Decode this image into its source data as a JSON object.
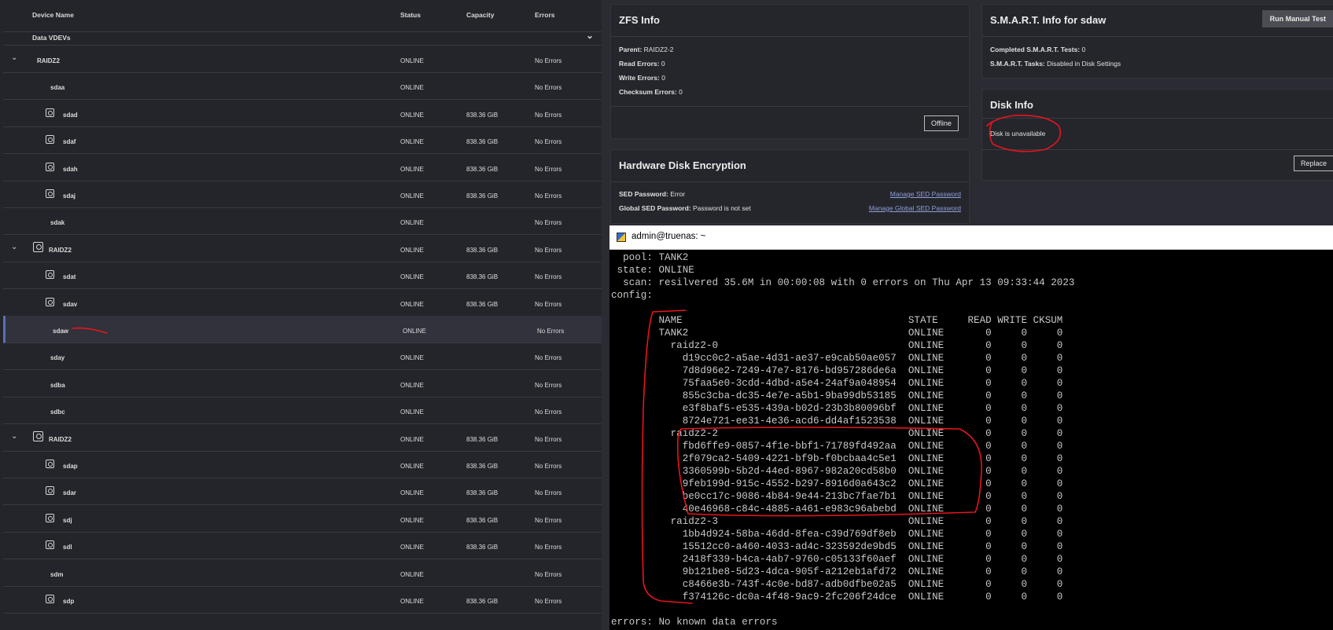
{
  "device_table": {
    "headers": {
      "name": "Device Name",
      "status": "Status",
      "capacity": "Capacity",
      "errors": "Errors"
    },
    "group_label": "Data VDEVs",
    "rows": [
      {
        "name": "RAIDZ2",
        "kind": "vdev",
        "icon": false,
        "status": "ONLINE",
        "capacity": "",
        "errors": "No Errors"
      },
      {
        "name": "sdaa",
        "kind": "disk",
        "icon": false,
        "status": "ONLINE",
        "capacity": "",
        "errors": "No Errors"
      },
      {
        "name": "sdad",
        "kind": "disk",
        "icon": true,
        "status": "ONLINE",
        "capacity": "838.36 GiB",
        "errors": "No Errors"
      },
      {
        "name": "sdaf",
        "kind": "disk",
        "icon": true,
        "status": "ONLINE",
        "capacity": "838.36 GiB",
        "errors": "No Errors"
      },
      {
        "name": "sdah",
        "kind": "disk",
        "icon": true,
        "status": "ONLINE",
        "capacity": "838.36 GiB",
        "errors": "No Errors"
      },
      {
        "name": "sdaj",
        "kind": "disk",
        "icon": true,
        "status": "ONLINE",
        "capacity": "838.36 GiB",
        "errors": "No Errors"
      },
      {
        "name": "sdak",
        "kind": "disk",
        "icon": false,
        "status": "ONLINE",
        "capacity": "",
        "errors": "No Errors"
      },
      {
        "name": "RAIDZ2",
        "kind": "vdev",
        "icon": true,
        "status": "ONLINE",
        "capacity": "838.36 GiB",
        "errors": "No Errors"
      },
      {
        "name": "sdat",
        "kind": "disk",
        "icon": true,
        "status": "ONLINE",
        "capacity": "838.36 GiB",
        "errors": "No Errors"
      },
      {
        "name": "sdav",
        "kind": "disk",
        "icon": true,
        "status": "ONLINE",
        "capacity": "838.36 GiB",
        "errors": "No Errors"
      },
      {
        "name": "sdaw",
        "kind": "disk",
        "icon": false,
        "status": "ONLINE",
        "capacity": "",
        "errors": "No Errors",
        "selected": true
      },
      {
        "name": "sday",
        "kind": "disk",
        "icon": false,
        "status": "ONLINE",
        "capacity": "",
        "errors": "No Errors"
      },
      {
        "name": "sdba",
        "kind": "disk",
        "icon": false,
        "status": "ONLINE",
        "capacity": "",
        "errors": "No Errors"
      },
      {
        "name": "sdbc",
        "kind": "disk",
        "icon": false,
        "status": "ONLINE",
        "capacity": "",
        "errors": "No Errors"
      },
      {
        "name": "RAIDZ2",
        "kind": "vdev",
        "icon": true,
        "status": "ONLINE",
        "capacity": "838.36 GiB",
        "errors": "No Errors"
      },
      {
        "name": "sdap",
        "kind": "disk",
        "icon": true,
        "status": "ONLINE",
        "capacity": "838.36 GiB",
        "errors": "No Errors"
      },
      {
        "name": "sdar",
        "kind": "disk",
        "icon": true,
        "status": "ONLINE",
        "capacity": "838.36 GiB",
        "errors": "No Errors"
      },
      {
        "name": "sdj",
        "kind": "disk",
        "icon": true,
        "status": "ONLINE",
        "capacity": "838.36 GiB",
        "errors": "No Errors"
      },
      {
        "name": "sdl",
        "kind": "disk",
        "icon": true,
        "status": "ONLINE",
        "capacity": "838.36 GiB",
        "errors": "No Errors"
      },
      {
        "name": "sdm",
        "kind": "disk",
        "icon": false,
        "status": "ONLINE",
        "capacity": "",
        "errors": "No Errors"
      },
      {
        "name": "sdp",
        "kind": "disk",
        "icon": true,
        "status": "ONLINE",
        "capacity": "838.36 GiB",
        "errors": "No Errors"
      }
    ]
  },
  "zfs_info": {
    "title": "ZFS Info",
    "parent_label": "Parent:",
    "parent_value": "RAIDZ2-2",
    "read_label": "Read Errors:",
    "read_value": "0",
    "write_label": "Write Errors:",
    "write_value": "0",
    "checksum_label": "Checksum Errors:",
    "checksum_value": "0",
    "offline_button": "Offline"
  },
  "smart_info": {
    "title": "S.M.A.R.T. Info for sdaw",
    "run_button": "Run Manual Test",
    "completed_label": "Completed S.M.A.R.T. Tests:",
    "completed_value": "0",
    "tasks_label": "S.M.A.R.T. Tasks:",
    "tasks_value": "Disabled in Disk Settings"
  },
  "disk_info": {
    "title": "Disk Info",
    "message": "Disk is unavailable",
    "replace_button": "Replace"
  },
  "hw_encryption": {
    "title": "Hardware Disk Encryption",
    "sed_label": "SED Password:",
    "sed_value": "Error",
    "global_label": "Global SED Password:",
    "global_value": "Password is not set",
    "manage_sed_link": "Manage SED Password",
    "manage_global_link": "Manage Global SED Password"
  },
  "terminal": {
    "title": "admin@truenas: ~",
    "lines": [
      "  pool: TANK2",
      " state: ONLINE",
      "  scan: resilvered 35.6M in 00:00:08 with 0 errors on Thu Apr 13 09:33:44 2023",
      "config:",
      "",
      "        NAME                                      STATE     READ WRITE CKSUM",
      "        TANK2                                     ONLINE       0     0     0",
      "          raidz2-0                                ONLINE       0     0     0",
      "            d19cc0c2-a5ae-4d31-ae37-e9cab50ae057  ONLINE       0     0     0",
      "            7d8d96e2-7249-47e7-8176-bd957286de6a  ONLINE       0     0     0",
      "            75faa5e0-3cdd-4dbd-a5e4-24af9a048954  ONLINE       0     0     0",
      "            855c3cba-dc35-4e7e-a5b1-9ba99db53185  ONLINE       0     0     0",
      "            e3f8baf5-e535-439a-b02d-23b3b80096bf  ONLINE       0     0     0",
      "            8724e721-ee31-4e36-acd6-dd4af1523538  ONLINE       0     0     0",
      "          raidz2-2                                ONLINE       0     0     0",
      "            fbd6ffe9-0857-4f1e-bbf1-71789fd492aa  ONLINE       0     0     0",
      "            2f079ca2-5409-4221-bf9b-f0bcbaa4c5e1  ONLINE       0     0     0",
      "            3360599b-5b2d-44ed-8967-982a20cd58b0  ONLINE       0     0     0",
      "            9feb199d-915c-4552-b297-8916d0a643c2  ONLINE       0     0     0",
      "            be0cc17c-9086-4b84-9e44-213bc7fae7b1  ONLINE       0     0     0",
      "            40e46968-c84c-4885-a461-e983c96abebd  ONLINE       0     0     0",
      "          raidz2-3                                ONLINE       0     0     0",
      "            1bb4d924-58ba-46dd-8fea-c39d769df8eb  ONLINE       0     0     0",
      "            15512cc0-a460-4033-ad4c-323592de9bd5  ONLINE       0     0     0",
      "            2418f339-b4ca-4ab7-9760-c05133f60aef  ONLINE       0     0     0",
      "            9b121be8-5d23-4dca-905f-a212eb1afd72  ONLINE       0     0     0",
      "            c8466e3b-743f-4c0e-bd87-adb0dfbe02a5  ONLINE       0     0     0",
      "            f374126c-dc0a-4f48-9ac9-2fc206f24dce  ONLINE       0     0     0",
      "",
      "errors: No known data errors"
    ]
  },
  "colors": {
    "annotation": "#e8141c",
    "link": "#8f9fd8",
    "selected_bar": "#5a6fb8"
  }
}
